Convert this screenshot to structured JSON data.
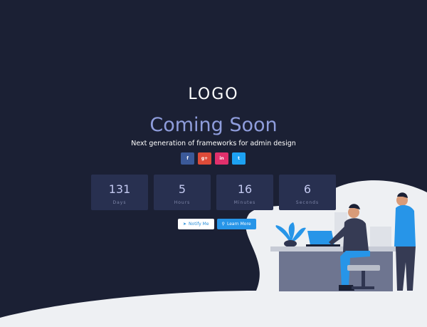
{
  "logo": "LOGO",
  "title": "Coming Soon",
  "subtitle": "Next generation of frameworks for admin design",
  "social": [
    {
      "name": "facebook",
      "glyph": "f",
      "color": "#3b5998"
    },
    {
      "name": "google-plus",
      "glyph": "g+",
      "color": "#dd4b39"
    },
    {
      "name": "instagram",
      "glyph": "in",
      "color": "#e1306c"
    },
    {
      "name": "twitter",
      "glyph": "t",
      "color": "#1da1f2"
    }
  ],
  "countdown": [
    {
      "value": "131",
      "label": "Days"
    },
    {
      "value": "5",
      "label": "Hours"
    },
    {
      "value": "16",
      "label": "Minutes"
    },
    {
      "value": "6",
      "label": "Seconds"
    }
  ],
  "actions": {
    "notify_label": "Notify Me",
    "notify_icon": "paper-plane-icon",
    "learn_label": "Learn More",
    "learn_icon": "search-icon"
  },
  "colors": {
    "background": "#1b2034",
    "accent": "#8f9ddc",
    "box": "#283050",
    "primary_button": "#2795e8"
  }
}
